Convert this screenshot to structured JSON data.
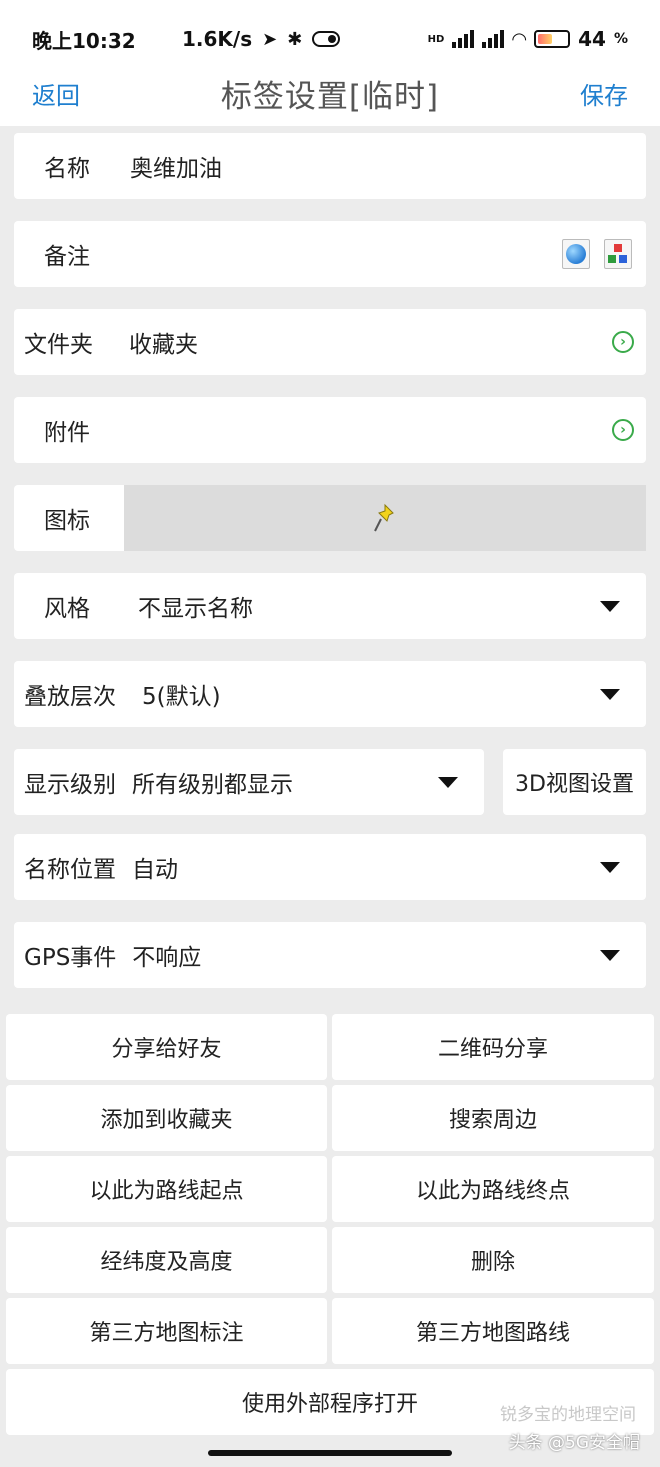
{
  "status_bar": {
    "time": "晚上10:32",
    "net_speed": "1.6K/s",
    "battery": "44",
    "battery_unit": "%",
    "hd_label": "HD"
  },
  "header": {
    "back": "返回",
    "title": "标签设置[临时]",
    "save": "保存"
  },
  "form": {
    "name_label": "名称",
    "name_value": "奥维加油",
    "note_label": "备注",
    "folder_label": "文件夹",
    "folder_value": "收藏夹",
    "attach_label": "附件",
    "icon_label": "图标",
    "style_label": "风格",
    "style_value": "不显示名称",
    "layer_label": "叠放层次",
    "layer_value": "5(默认)",
    "level_label": "显示级别",
    "level_value": "所有级别都显示",
    "view3d_label": "3D视图设置",
    "namepos_label": "名称位置",
    "namepos_value": "自动",
    "gps_label": "GPS事件",
    "gps_value": "不响应"
  },
  "actions": {
    "share_friend": "分享给好友",
    "qr_share": "二维码分享",
    "add_fav": "添加到收藏夹",
    "search_near": "搜索周边",
    "route_start": "以此为路线起点",
    "route_end": "以此为路线终点",
    "latlng": "经纬度及高度",
    "delete": "删除",
    "third_mark": "第三方地图标注",
    "third_route": "第三方地图路线",
    "open_external": "使用外部程序打开"
  },
  "watermark": {
    "line1": "锐多宝的地理空间",
    "line2": "头条 @5G安全帽"
  },
  "colors": {
    "accent": "#1f7fcf",
    "chevron": "#3aaa4a",
    "background": "#ececec"
  }
}
